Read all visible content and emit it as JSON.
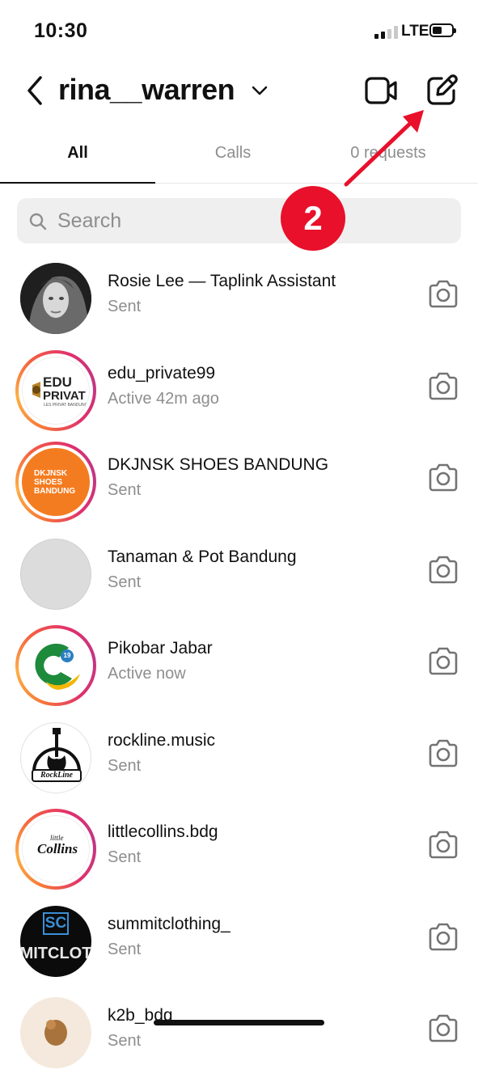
{
  "status_bar": {
    "time": "10:30",
    "network": "LTE"
  },
  "header": {
    "username": "rina__warren"
  },
  "tabs": [
    {
      "label": "All",
      "active": true
    },
    {
      "label": "Calls",
      "active": false
    },
    {
      "label": "0 requests",
      "active": false
    }
  ],
  "search": {
    "placeholder": "Search",
    "value": ""
  },
  "conversations": [
    {
      "name": "Rosie Lee — Taplink Assistant",
      "status": "Sent",
      "story_ring": false
    },
    {
      "name": "edu_private99",
      "status": "Active 42m ago",
      "story_ring": true,
      "avatar_text": [
        "EDU",
        "PRIVAT",
        "LES PRIVAT BANDUNG"
      ]
    },
    {
      "name": "DKJNSK SHOES BANDUNG",
      "status": "Sent",
      "story_ring": true,
      "avatar_text": [
        "DKJNSK",
        "SHOES",
        "BANDUNG"
      ]
    },
    {
      "name": "Tanaman & Pot Bandung",
      "status": "Sent",
      "story_ring": false
    },
    {
      "name": "Pikobar Jabar",
      "status": "Active now",
      "story_ring": true,
      "avatar_text": [
        "19"
      ]
    },
    {
      "name": "rockline.music",
      "status": "Sent",
      "story_ring": false,
      "avatar_text": [
        "RockLine"
      ]
    },
    {
      "name": "littlecollins.bdg",
      "status": "Sent",
      "story_ring": true,
      "avatar_text": [
        "little",
        "Collins"
      ]
    },
    {
      "name": "summitclothing_",
      "status": "Sent",
      "story_ring": false,
      "avatar_text": [
        "SC",
        "MITCLOT"
      ]
    },
    {
      "name": "k2b_bdg",
      "status": "Sent",
      "story_ring": false
    }
  ],
  "annotation": {
    "step": "2"
  },
  "colors": {
    "annotation_red": "#e8102a",
    "secondary_text": "#8e8e8e",
    "search_bg": "#efefef"
  }
}
